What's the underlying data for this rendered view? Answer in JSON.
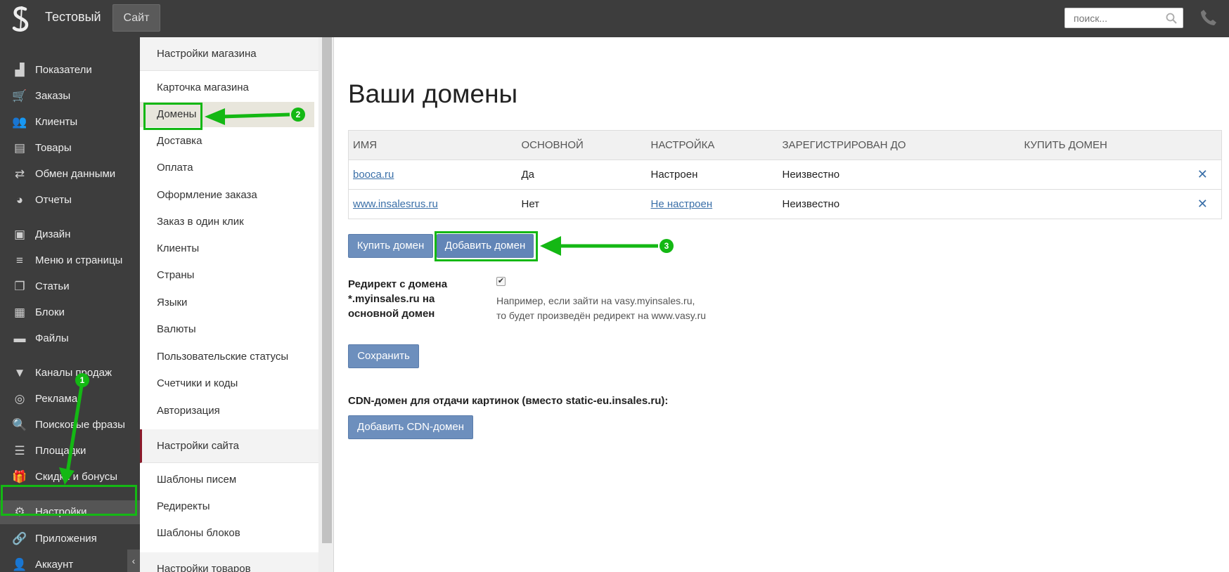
{
  "topbar": {
    "shop_name": "Тестовый",
    "site_button": "Сайт",
    "search_placeholder": "поиск..."
  },
  "sidebar": {
    "items": [
      {
        "label": "Показатели",
        "icon": "chart-icon"
      },
      {
        "label": "Заказы",
        "icon": "cart-icon"
      },
      {
        "label": "Клиенты",
        "icon": "users-icon"
      },
      {
        "label": "Товары",
        "icon": "book-icon"
      },
      {
        "label": "Обмен данными",
        "icon": "exchange-icon"
      },
      {
        "label": "Отчеты",
        "icon": "pie-chart-icon"
      },
      {
        "label": "Дизайн",
        "icon": "image-icon"
      },
      {
        "label": "Меню и страницы",
        "icon": "menu-lines-icon"
      },
      {
        "label": "Статьи",
        "icon": "copy-icon"
      },
      {
        "label": "Блоки",
        "icon": "table-icon"
      },
      {
        "label": "Файлы",
        "icon": "folder-icon"
      },
      {
        "label": "Каналы продаж",
        "icon": "filter-icon"
      },
      {
        "label": "Реклама",
        "icon": "target-icon"
      },
      {
        "label": "Поисковые фразы",
        "icon": "search-icon"
      },
      {
        "label": "Площадки",
        "icon": "list-icon"
      },
      {
        "label": "Скидки и бонусы",
        "icon": "gift-icon"
      },
      {
        "label": "Настройки",
        "icon": "gear-icon"
      },
      {
        "label": "Приложения",
        "icon": "link-icon"
      },
      {
        "label": "Аккаунт",
        "icon": "user-icon"
      }
    ]
  },
  "submenu": {
    "shop_settings": "Настройки магазина",
    "shop_items": [
      "Карточка магазина",
      "Домены",
      "Доставка",
      "Оплата",
      "Оформление заказа",
      "Заказ в один клик",
      "Клиенты",
      "Страны",
      "Языки",
      "Валюты",
      "Пользовательские статусы",
      "Счетчики и коды",
      "Авторизация"
    ],
    "site_settings": "Настройки сайта",
    "site_items": [
      "Шаблоны писем",
      "Редиректы",
      "Шаблоны блоков"
    ],
    "product_settings": "Настройки товаров"
  },
  "main": {
    "title": "Ваши домены",
    "columns": [
      "ИМЯ",
      "ОСНОВНОЙ",
      "НАСТРОЙКА",
      "ЗАРЕГИСТРИРОВАН ДО",
      "КУПИТЬ ДОМЕН"
    ],
    "rows": [
      {
        "name": "booca.ru",
        "primary": "Да",
        "setup": "Настроен",
        "registered": "Неизвестно"
      },
      {
        "name": "www.insalesrus.ru",
        "primary": "Нет",
        "setup": "Не настроен",
        "registered": "Неизвестно"
      }
    ],
    "buy_domain_button": "Купить домен",
    "add_domain_button": "Добавить домен",
    "redirect_label": "Редирект с домена *.myinsales.ru на основной домен",
    "redirect_hint_1": "Например, если зайти на vasy.myinsales.ru,",
    "redirect_hint_2": "то будет произведён редирект на www.vasy.ru",
    "save_button": "Сохранить",
    "cdn_label": "CDN-домен для отдачи картинок (вместо static-eu.insales.ru):",
    "add_cdn_button": "Добавить CDN-домен"
  },
  "annotations": {
    "badge_1": "1",
    "badge_2": "2",
    "badge_3": "3",
    "highlight_color": "#14b814"
  }
}
